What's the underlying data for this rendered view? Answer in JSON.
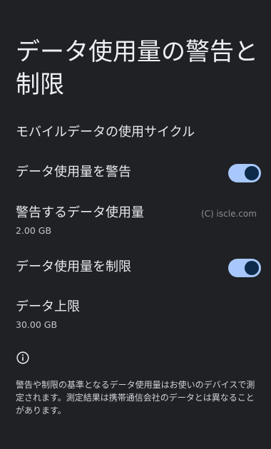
{
  "header": {
    "title": "データ使用量の警告と制限"
  },
  "settings": {
    "cycle_label": "モバイルデータの使用サイクル",
    "warning_toggle_label": "データ使用量を警告",
    "warning_toggle_on": true,
    "warning_amount_label": "警告するデータ使用量",
    "warning_amount_value": "2.00 GB",
    "limit_toggle_label": "データ使用量を制限",
    "limit_toggle_on": true,
    "limit_label": "データ上限",
    "limit_value": "30.00 GB"
  },
  "watermark": "(C) iscle.com",
  "footer": {
    "icon": "info-icon",
    "text": "警告や制限の基準となるデータ使用量はお使いのデバイスで測定されます。測定結果は携帯通信会社のデータとは異なることがあります。"
  },
  "colors": {
    "background": "#1f2125",
    "toggle_track": "#a8c7fa",
    "toggle_knob": "#0d2a4a"
  }
}
